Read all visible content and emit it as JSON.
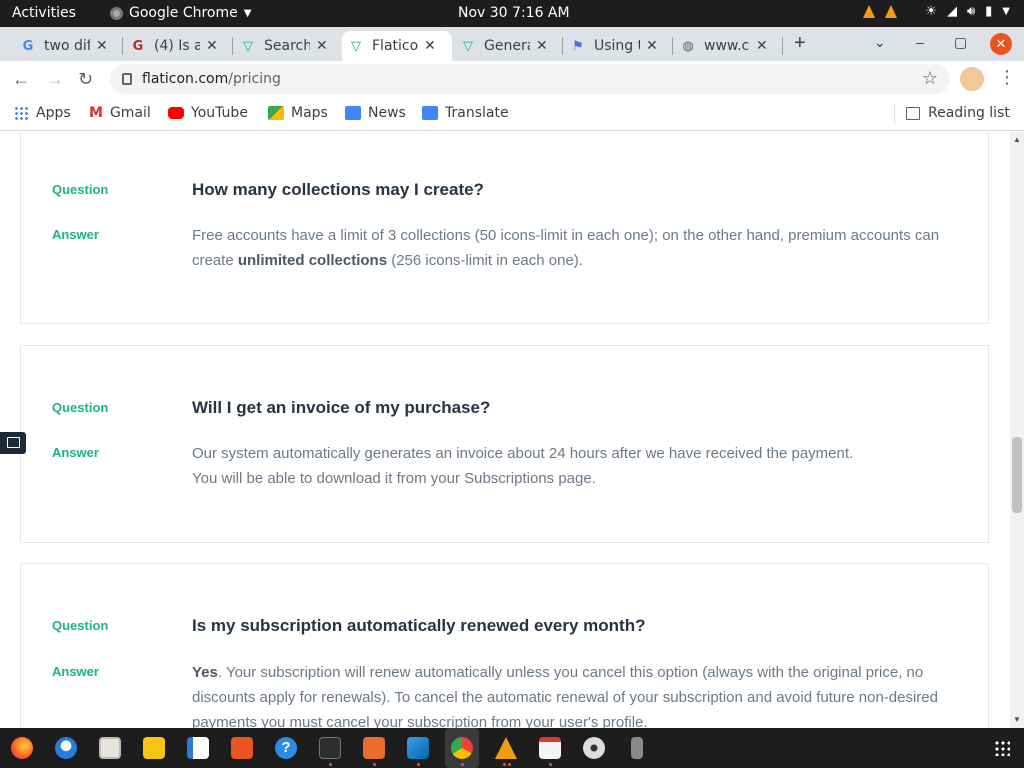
{
  "topbar": {
    "activities": "Activities",
    "app_name": "Google Chrome",
    "clock": "Nov 30  7:16 AM"
  },
  "tabs": [
    {
      "label": "two dif",
      "icon": "google-icon",
      "active": false
    },
    {
      "label": "(4) Is a",
      "icon": "quora-icon",
      "active": false
    },
    {
      "label": "Search",
      "icon": "flaticon-icon",
      "active": false
    },
    {
      "label": "Flatico",
      "icon": "flaticon-icon",
      "active": true
    },
    {
      "label": "Genera",
      "icon": "flaticon-icon",
      "active": false
    },
    {
      "label": "Using t",
      "icon": "flag-icon",
      "active": false
    },
    {
      "label": "www.c",
      "icon": "globe-icon",
      "active": false
    }
  ],
  "omnibox": {
    "host": "flaticon.com",
    "path": "/pricing"
  },
  "bookmarks": {
    "items": [
      "Apps",
      "Gmail",
      "YouTube",
      "Maps",
      "News",
      "Translate"
    ],
    "reading_list": "Reading list"
  },
  "faq": [
    {
      "question_label": "Question",
      "answer_label": "Answer",
      "question": "How many collections may I create?",
      "answer_pre": "Free accounts have a limit of 3 collections (50 icons-limit in each one); on the other hand, premium accounts can create ",
      "answer_bold": "unlimited collections",
      "answer_post": " (256 icons-limit in each one)."
    },
    {
      "question_label": "Question",
      "answer_label": "Answer",
      "question": "Will I get an invoice of my purchase?",
      "answer_line1": "Our system automatically generates an invoice about 24 hours after we have received the payment.",
      "answer_line2": "You will be able to download it from your Subscriptions page."
    },
    {
      "question_label": "Question",
      "answer_label": "Answer",
      "question": "Is my subscription automatically renewed every month?",
      "answer_bold": "Yes",
      "answer_post": ". Your subscription will renew automatically unless you cancel this option (always with the original price, no discounts apply for renewals). To cancel the automatic renewal of your subscription and avoid future non-desired payments you must cancel your subscription from your user's profile."
    }
  ],
  "colors": {
    "accent_green": "#1bb38a",
    "heading": "#273444",
    "body_text": "#6b7a8a",
    "ubuntu_orange": "#e95420"
  }
}
